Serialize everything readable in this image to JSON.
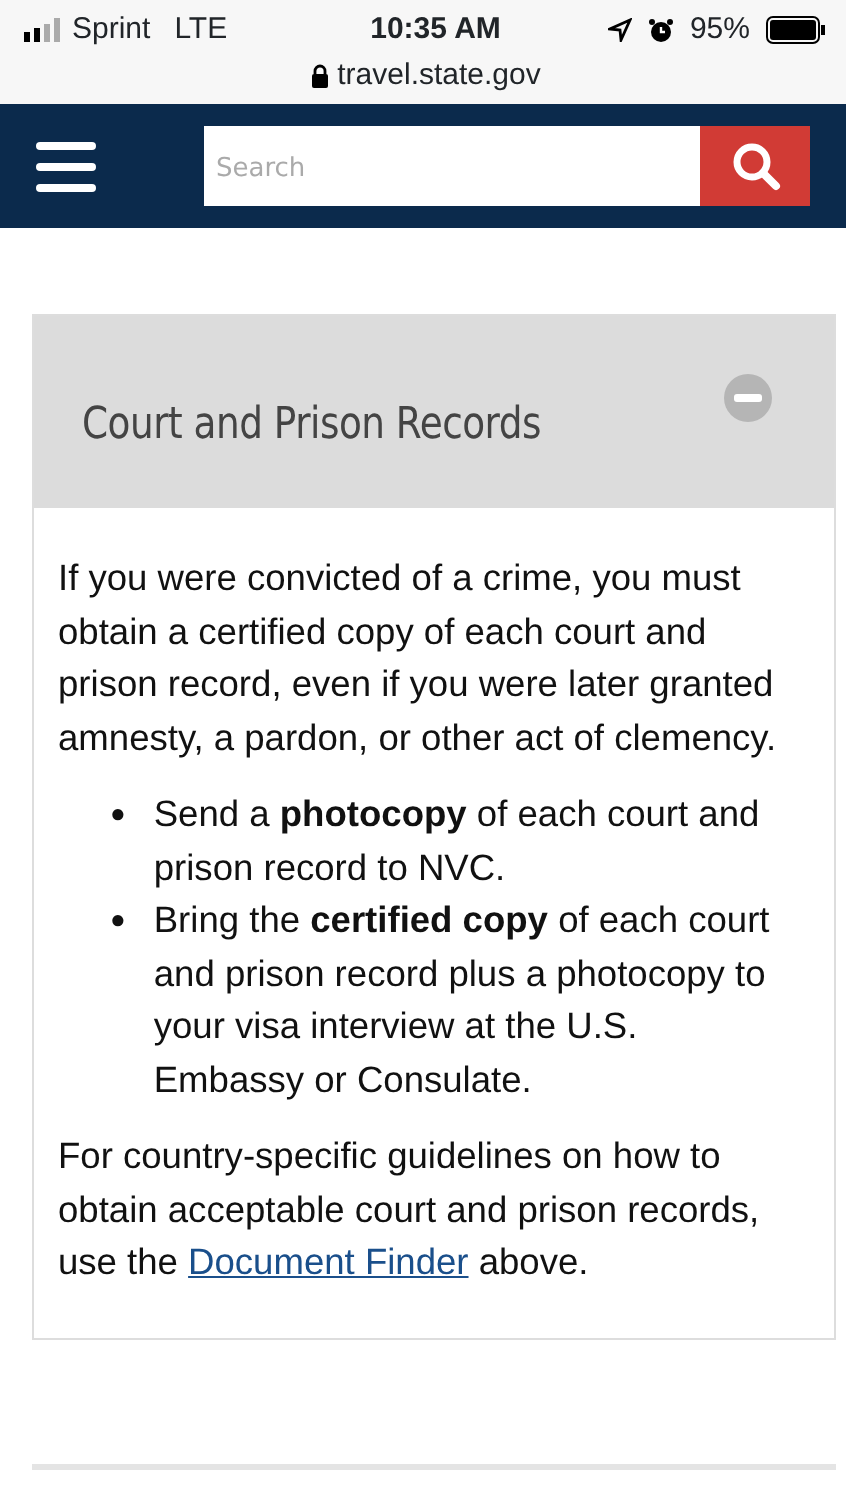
{
  "status_bar": {
    "carrier": "Sprint",
    "network": "LTE",
    "time": "10:35 AM",
    "battery": "95%",
    "url": "travel.state.gov"
  },
  "navbar": {
    "search": {
      "placeholder": "Search"
    }
  },
  "accordion": {
    "title": "Court and Prison Records",
    "expanded": true,
    "intro": "If you were convicted of a crime, you must obtain a certified copy of each court and prison record, even if you were later granted amnesty, a pardon, or other act of clemency.",
    "bullets": [
      {
        "marker": "●",
        "text": "Send a **photocopy** of each court and prison record to NVC."
      },
      {
        "marker": "●",
        "text": "Bring the **certified copy** of each court and prison record plus a photocopy to your visa interview at the U.S. Embassy or Consulate."
      }
    ],
    "closing": {
      "before": "For country-specific guidelines on how to obtain acceptable court and prison records, use the",
      "link": "Document Finder",
      "after": "above."
    }
  }
}
